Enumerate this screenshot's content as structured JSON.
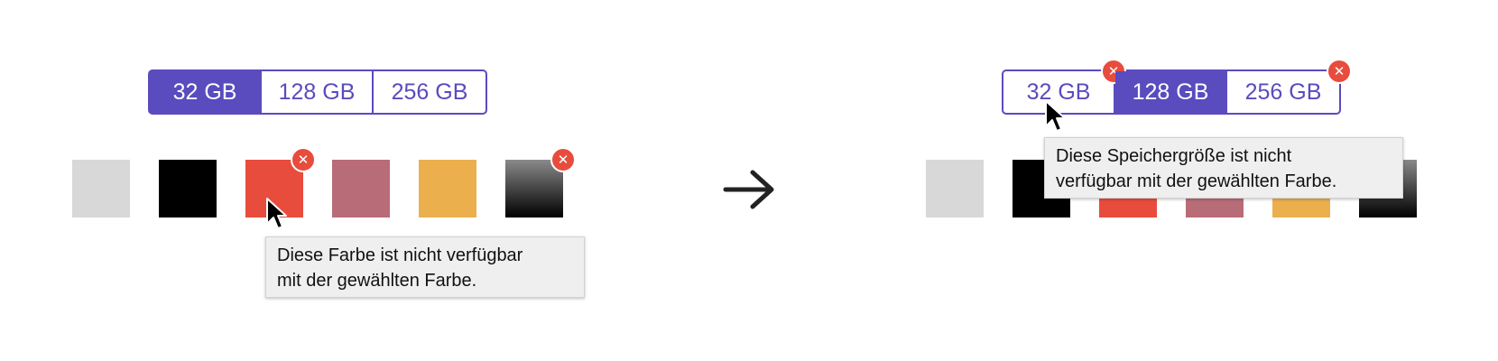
{
  "colors": {
    "accent": "#5a4bbe",
    "error_badge": "#e84c3d",
    "swatches": [
      "#d8d8d8",
      "#000000",
      "#e84c3d",
      "#b86c77",
      "#ebaf4e",
      "gradient-gray-black"
    ]
  },
  "before": {
    "storage_options": [
      {
        "label": "32 GB",
        "state": "selected"
      },
      {
        "label": "128 GB",
        "state": "available"
      },
      {
        "label": "256 GB",
        "state": "available"
      }
    ],
    "color_swatches": [
      {
        "color": "light-gray",
        "unavailable": false
      },
      {
        "color": "black",
        "unavailable": false
      },
      {
        "color": "red",
        "unavailable": true
      },
      {
        "color": "rose",
        "unavailable": false
      },
      {
        "color": "yellow",
        "unavailable": false
      },
      {
        "color": "gray-to-black-gradient",
        "unavailable": true
      }
    ],
    "tooltip": "Diese Farbe ist nicht verfügbar\nmit der gewählten Farbe.",
    "badge_icon": "close-icon",
    "cursor_icon": "mouse-pointer-icon"
  },
  "transition_icon": "right-arrow-icon",
  "after": {
    "storage_options": [
      {
        "label": "32 GB",
        "state": "unavailable"
      },
      {
        "label": "128 GB",
        "state": "selected"
      },
      {
        "label": "256 GB",
        "state": "unavailable"
      }
    ],
    "color_swatches": [
      {
        "color": "light-gray"
      },
      {
        "color": "black"
      },
      {
        "color": "red"
      },
      {
        "color": "rose"
      },
      {
        "color": "yellow"
      },
      {
        "color": "gray-to-black-gradient"
      }
    ],
    "tooltip": "Diese Speichergröße ist nicht\nverfügbar mit der gewählten Farbe.",
    "badge_icon": "close-icon",
    "cursor_icon": "mouse-pointer-icon"
  }
}
